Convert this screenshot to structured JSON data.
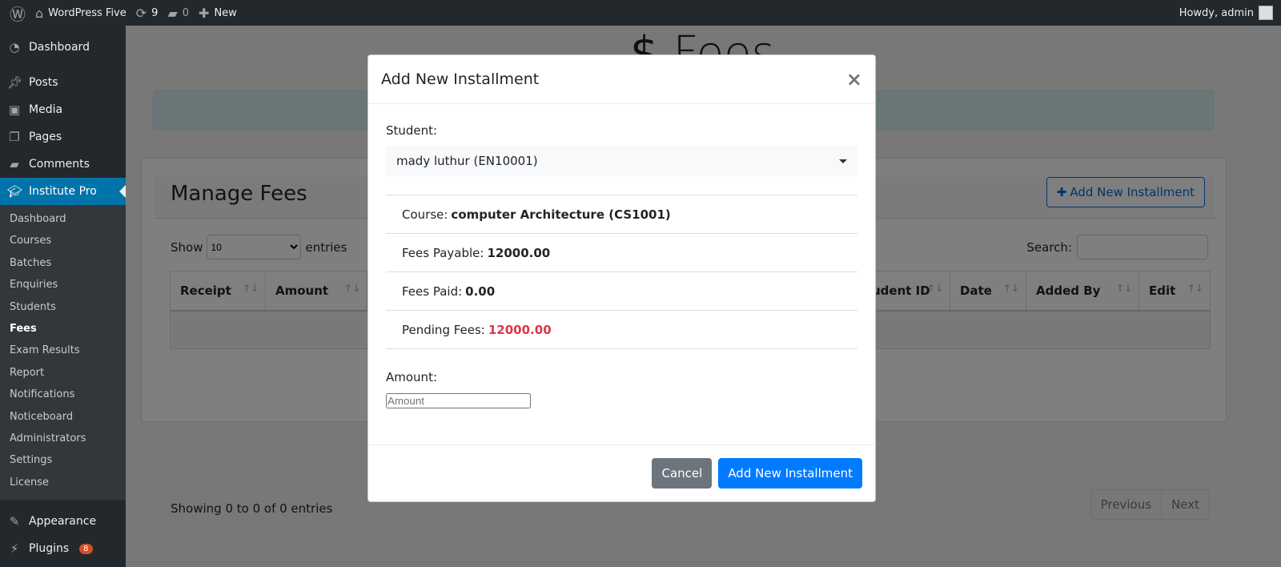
{
  "adminbar": {
    "site": "WordPress Five",
    "updates": "9",
    "comments": "0",
    "new": "New",
    "howdy": "Howdy, admin"
  },
  "sidebar": {
    "top": [
      {
        "label": "Dashboard",
        "icon": "dashboard-icon"
      },
      {
        "label": "Posts",
        "icon": "pin-icon"
      },
      {
        "label": "Media",
        "icon": "media-icon"
      },
      {
        "label": "Pages",
        "icon": "pages-icon"
      },
      {
        "label": "Comments",
        "icon": "comment-icon"
      },
      {
        "label": "Institute Pro",
        "icon": "graduation-cap-icon"
      }
    ],
    "sub": [
      "Dashboard",
      "Courses",
      "Batches",
      "Enquiries",
      "Students",
      "Fees",
      "Exam Results",
      "Report",
      "Notifications",
      "Noticeboard",
      "Administrators",
      "Settings",
      "License"
    ],
    "bottom": [
      {
        "label": "Appearance",
        "icon": "brush-icon"
      },
      {
        "label": "Plugins",
        "icon": "plugin-icon",
        "badge": "8"
      }
    ]
  },
  "page": {
    "title_icon": "$",
    "title": "Fees",
    "card_title": "Manage Fees",
    "add_button": "Add New Installment",
    "show": "Show",
    "show_value": "10",
    "entries": "entries",
    "search": "Search:",
    "columns": [
      "Receipt",
      "Amount",
      "",
      "Student ID",
      "Date",
      "Added By",
      "Edit"
    ],
    "info": "Showing 0 to 0 of 0 entries",
    "prev": "Previous",
    "next": "Next"
  },
  "modal": {
    "title": "Add New Installment",
    "close": "×",
    "student_label": "Student:",
    "student_value": "mady luthur (EN10001)",
    "course_label": "Course:",
    "course_value": "computer Architecture (CS1001)",
    "payable_label": "Fees Payable:",
    "payable_value": "12000.00",
    "paid_label": "Fees Paid:",
    "paid_value": "0.00",
    "pending_label": "Pending Fees:",
    "pending_value": "12000.00",
    "amount_label": "Amount:",
    "amount_placeholder": "Amount",
    "cancel": "Cancel",
    "submit": "Add New Installment"
  },
  "colors": {
    "primary": "#007bff",
    "danger": "#dc3545",
    "wp_blue": "#0073aa"
  }
}
